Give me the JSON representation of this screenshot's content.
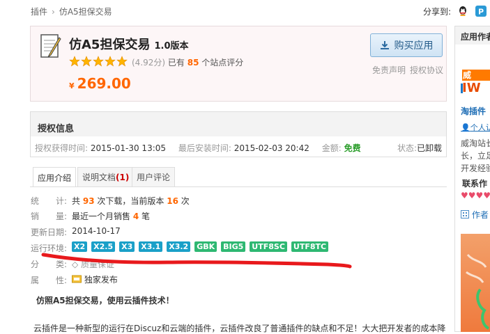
{
  "breadcrumb": {
    "root": "插件",
    "sep": "›",
    "current": "仿A5担保交易"
  },
  "share": {
    "label": "分享到:"
  },
  "product": {
    "title": "仿A5担保交易",
    "version": "1.0版本",
    "rating_score": "(4.92分)",
    "rating_prefix": "已有",
    "rating_count": "85",
    "rating_suffix": "个站点评分",
    "star_count": 5,
    "price_symbol": "¥",
    "price": "269.00",
    "buy_label": "购买应用",
    "disclaimer": "免责声明",
    "license": "授权协议"
  },
  "auth": {
    "title": "授权信息",
    "obtained_label": "授权获得时间:",
    "obtained_value": "2015-01-30 13:05",
    "installed_label": "最后安装时间:",
    "installed_value": "2015-02-03 20:42",
    "amount_label": "金额:",
    "amount_value": "免费",
    "state_label": "状态:",
    "state_value": "已卸载"
  },
  "tabs": {
    "intro": "应用介绍",
    "docs": "说明文档",
    "docs_count": "(1)",
    "reviews": "用户评论"
  },
  "info": {
    "stats_label": "统　　计:",
    "stats_a": "共",
    "stats_downloads": "93",
    "stats_b": "次下载，当前版本",
    "stats_version_downloads": "16",
    "stats_c": "次",
    "sales_label": "销　　量:",
    "sales_a": "最近一个月销售",
    "sales_count": "4",
    "sales_b": "笔",
    "updated_label": "更新日期:",
    "updated_value": "2014-10-17",
    "env_label": "运行环境:",
    "env_tags": [
      "X2",
      "X2.5",
      "X3",
      "X3.1",
      "X3.2",
      "GBK",
      "BIG5",
      "UTF8SC",
      "UTF8TC"
    ],
    "cat_label": "分　　类:",
    "cat_value": "质量保证",
    "attr_label": "属　　性:",
    "attr_value": "独家发布"
  },
  "description": {
    "headline": "仿照A5担保交易，使用云插件技术！",
    "body": "云插件是一种新型的运行在Discuz和云端的插件，云插件改良了普通插件的缺点和不足！大大把开发者的成本降"
  },
  "sidebar": {
    "title": "应用作者",
    "name": "淘插件",
    "person": "个人认",
    "text1": "威淘站长",
    "text2": "长，立足",
    "text3": "开发经验",
    "contact": "联系作",
    "hearts": "♥♥♥♥",
    "author_link": "作者"
  },
  "colors": {
    "accent": "#f60",
    "link": "#1d6db5",
    "annotation": "#e8191c"
  }
}
